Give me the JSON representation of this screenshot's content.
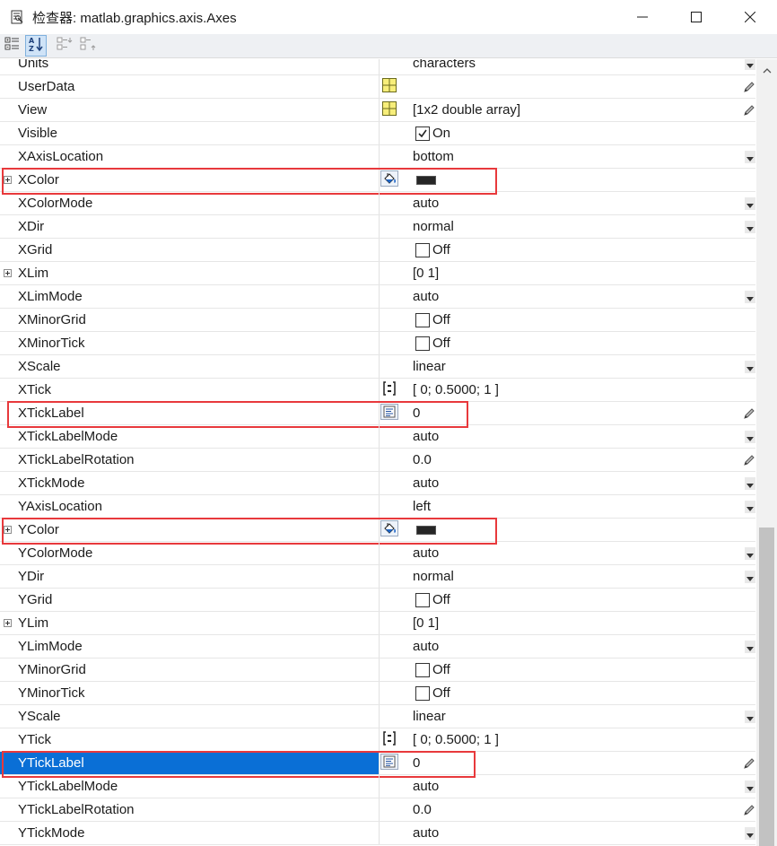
{
  "window": {
    "title": "检查器:  matlab.graphics.axis.Axes",
    "title_icon": "inspector-icon",
    "buttons": [
      "minimize-icon",
      "maximize-icon",
      "close-icon"
    ]
  },
  "toolbar": {
    "buttons": [
      "categorized-view-icon",
      "sort-alphabetically-icon",
      "expand-all-icon",
      "collapse-all-icon"
    ],
    "active": "sort-alphabetically-icon"
  },
  "colors": {
    "selection": "#0a6fd6",
    "highlight": "#e8393c",
    "swatch": "#262626"
  },
  "properties": [
    {
      "name": "Units",
      "value": "characters",
      "control": "dropdown"
    },
    {
      "name": "UserData",
      "value": "",
      "cell_icon": "grid-editor-icon",
      "control": "pencil"
    },
    {
      "name": "View",
      "value": "[1x2  double array]",
      "cell_icon": "grid-editor-icon",
      "control": "pencil"
    },
    {
      "name": "Visible",
      "value": "On",
      "checkbox": true,
      "checked": true
    },
    {
      "name": "XAxisLocation",
      "value": "bottom",
      "control": "dropdown"
    },
    {
      "name": "XColor",
      "value": "",
      "expandable": true,
      "cell_icon": "paint-bucket-icon",
      "swatch": true,
      "highlight": true
    },
    {
      "name": "XColorMode",
      "value": "auto",
      "control": "dropdown"
    },
    {
      "name": "XDir",
      "value": "normal",
      "control": "dropdown"
    },
    {
      "name": "XGrid",
      "value": "Off",
      "checkbox": true,
      "checked": false
    },
    {
      "name": "XLim",
      "value": "[0 1]",
      "expandable": true
    },
    {
      "name": "XLimMode",
      "value": "auto",
      "control": "dropdown"
    },
    {
      "name": "XMinorGrid",
      "value": "Off",
      "checkbox": true,
      "checked": false
    },
    {
      "name": "XMinorTick",
      "value": "Off",
      "checkbox": true,
      "checked": false
    },
    {
      "name": "XScale",
      "value": "linear",
      "control": "dropdown"
    },
    {
      "name": "XTick",
      "value": "[ 0; 0.5000; 1 ]",
      "cell_icon": "matrix-icon"
    },
    {
      "name": "XTickLabel",
      "value": "0",
      "cell_icon": "text-list-icon",
      "control": "pencil",
      "highlight": true
    },
    {
      "name": "XTickLabelMode",
      "value": "auto",
      "control": "dropdown"
    },
    {
      "name": "XTickLabelRotation",
      "value": "0.0",
      "control": "pencil"
    },
    {
      "name": "XTickMode",
      "value": "auto",
      "control": "dropdown"
    },
    {
      "name": "YAxisLocation",
      "value": "left",
      "control": "dropdown"
    },
    {
      "name": "YColor",
      "value": "",
      "expandable": true,
      "cell_icon": "paint-bucket-icon",
      "swatch": true,
      "highlight": true
    },
    {
      "name": "YColorMode",
      "value": "auto",
      "control": "dropdown"
    },
    {
      "name": "YDir",
      "value": "normal",
      "control": "dropdown"
    },
    {
      "name": "YGrid",
      "value": "Off",
      "checkbox": true,
      "checked": false
    },
    {
      "name": "YLim",
      "value": "[0 1]",
      "expandable": true
    },
    {
      "name": "YLimMode",
      "value": "auto",
      "control": "dropdown"
    },
    {
      "name": "YMinorGrid",
      "value": "Off",
      "checkbox": true,
      "checked": false
    },
    {
      "name": "YMinorTick",
      "value": "Off",
      "checkbox": true,
      "checked": false
    },
    {
      "name": "YScale",
      "value": "linear",
      "control": "dropdown"
    },
    {
      "name": "YTick",
      "value": "[ 0; 0.5000; 1 ]",
      "cell_icon": "matrix-icon"
    },
    {
      "name": "YTickLabel",
      "value": "0",
      "cell_icon": "text-list-icon",
      "control": "pencil",
      "highlight": true,
      "selected": true
    },
    {
      "name": "YTickLabelMode",
      "value": "auto",
      "control": "dropdown"
    },
    {
      "name": "YTickLabelRotation",
      "value": "0.0",
      "control": "pencil"
    },
    {
      "name": "YTickMode",
      "value": "auto",
      "control": "dropdown"
    }
  ]
}
